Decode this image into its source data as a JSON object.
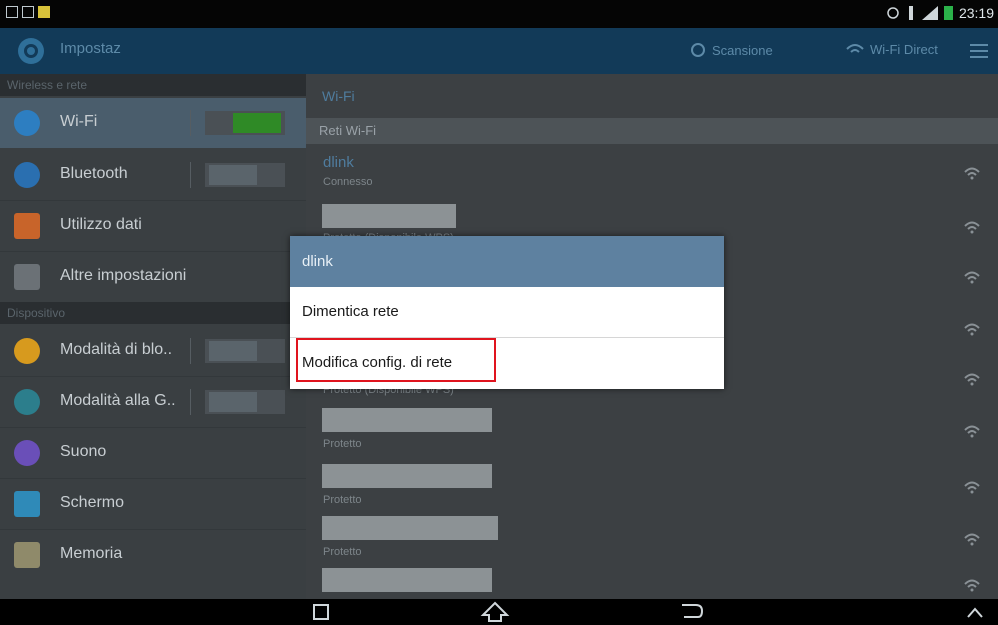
{
  "status_bar": {
    "left_icons": [
      "notification-icon",
      "image-icon",
      "message-icon"
    ],
    "right_icons": [
      "alarm-icon",
      "signal-icon",
      "battery-icon"
    ],
    "time": "23:19"
  },
  "action_bar": {
    "title": "Impostaz",
    "scan_label": "Scansione",
    "wifi_direct_label": "Wi-Fi Direct",
    "menu_icon": "menu-icon"
  },
  "left_pane": {
    "section_wireless": "Wireless e rete",
    "section_devices": "Dispositivo",
    "items": [
      {
        "label": "Wi-Fi",
        "toggle": "on"
      },
      {
        "label": "Bluetooth",
        "toggle": "off"
      },
      {
        "label": "Utilizzo dati"
      },
      {
        "label": "Altre impostazioni"
      },
      {
        "label": "Modalità di blo..",
        "toggle": "off"
      },
      {
        "label": "Modalità alla G..",
        "toggle": "off"
      },
      {
        "label": "Suono"
      },
      {
        "label": "Schermo"
      },
      {
        "label": "Memoria"
      }
    ]
  },
  "right_pane": {
    "title": "Wi-Fi",
    "subheader": "Reti Wi-Fi",
    "networks": [
      {
        "name": "dlink",
        "status": "Connesso"
      },
      {
        "name": "",
        "status": "Protetto (Disponibile WPS)"
      },
      {
        "name": "",
        "status": ""
      },
      {
        "name": "",
        "status": ""
      },
      {
        "name": "",
        "status": "Protetto (Disponibile WPS)"
      },
      {
        "name": "",
        "status": "Protetto"
      },
      {
        "name": "",
        "status": "Protetto"
      },
      {
        "name": "",
        "status": "Protetto"
      },
      {
        "name": "",
        "status": "Protetto"
      }
    ]
  },
  "dialog": {
    "title": "dlink",
    "options": [
      "Dimentica rete",
      "Modifica config. di rete"
    ]
  },
  "colors": {
    "action_bar": "#123a58",
    "accent": "#4f7c9e",
    "dialog_title": "#5e81a0",
    "highlight": "#e0141e",
    "toggle_on": "#2f8a26"
  }
}
